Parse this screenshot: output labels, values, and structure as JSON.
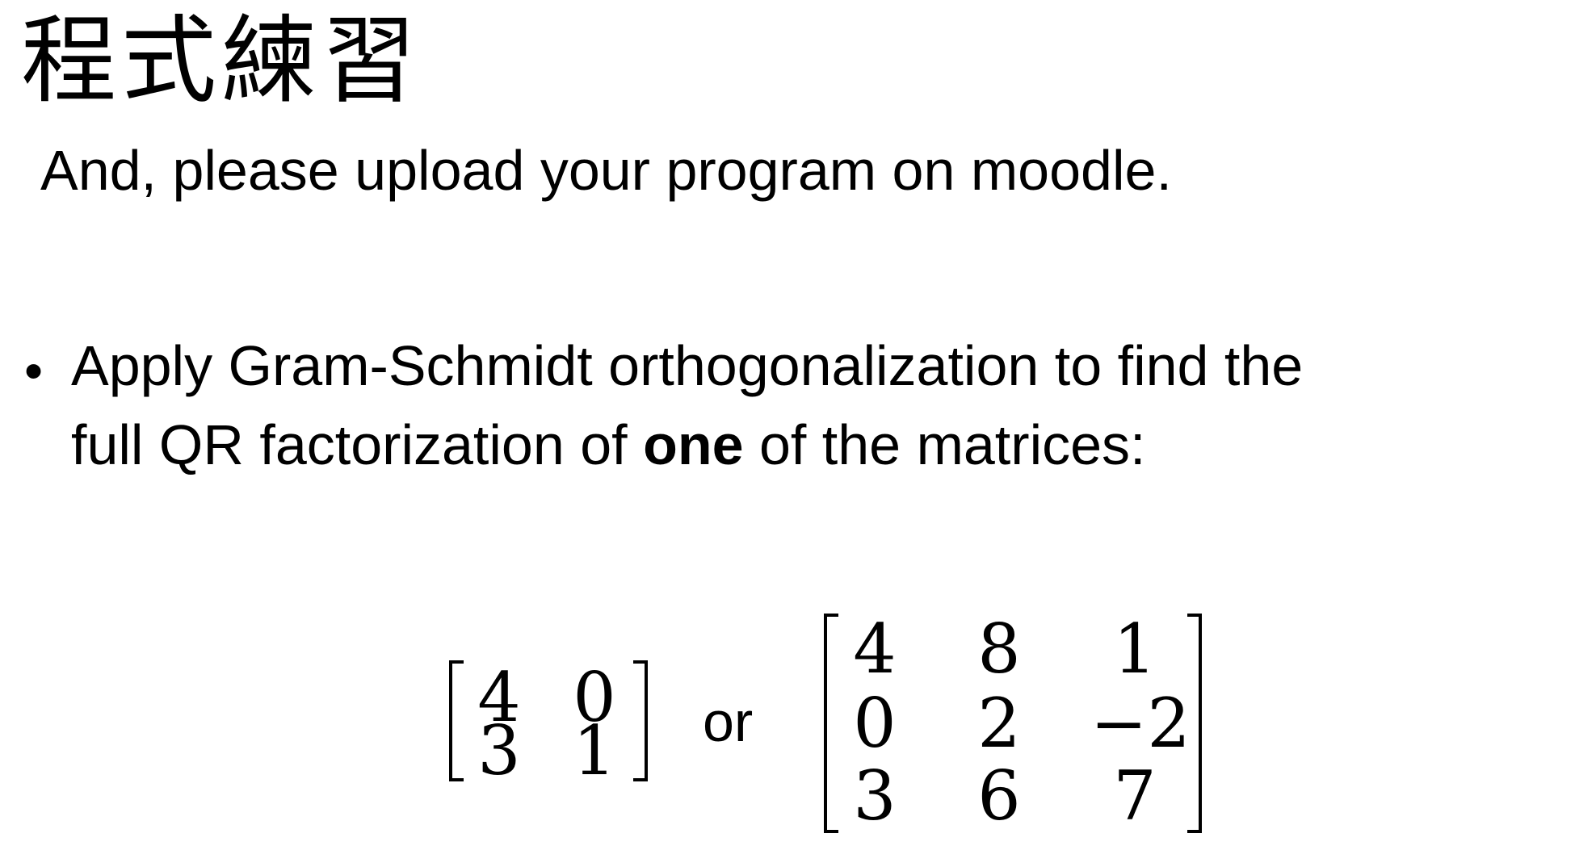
{
  "slide": {
    "title": "程式練習",
    "subtitle": "And, please upload your program on moodle.",
    "bullet": {
      "symbol": "•",
      "line1": "Apply Gram-Schmidt orthogonalization to find the",
      "line2_before": "full QR factorization of ",
      "line2_bold": "one",
      "line2_after": " of the matrices:"
    },
    "matrices": {
      "matrix_a": [
        [
          "4",
          "0"
        ],
        [
          "3",
          "1"
        ]
      ],
      "connector": "or",
      "matrix_b": [
        [
          "4",
          "8",
          "1"
        ],
        [
          "0",
          "2",
          "−2"
        ],
        [
          "3",
          "6",
          "7"
        ]
      ]
    }
  }
}
